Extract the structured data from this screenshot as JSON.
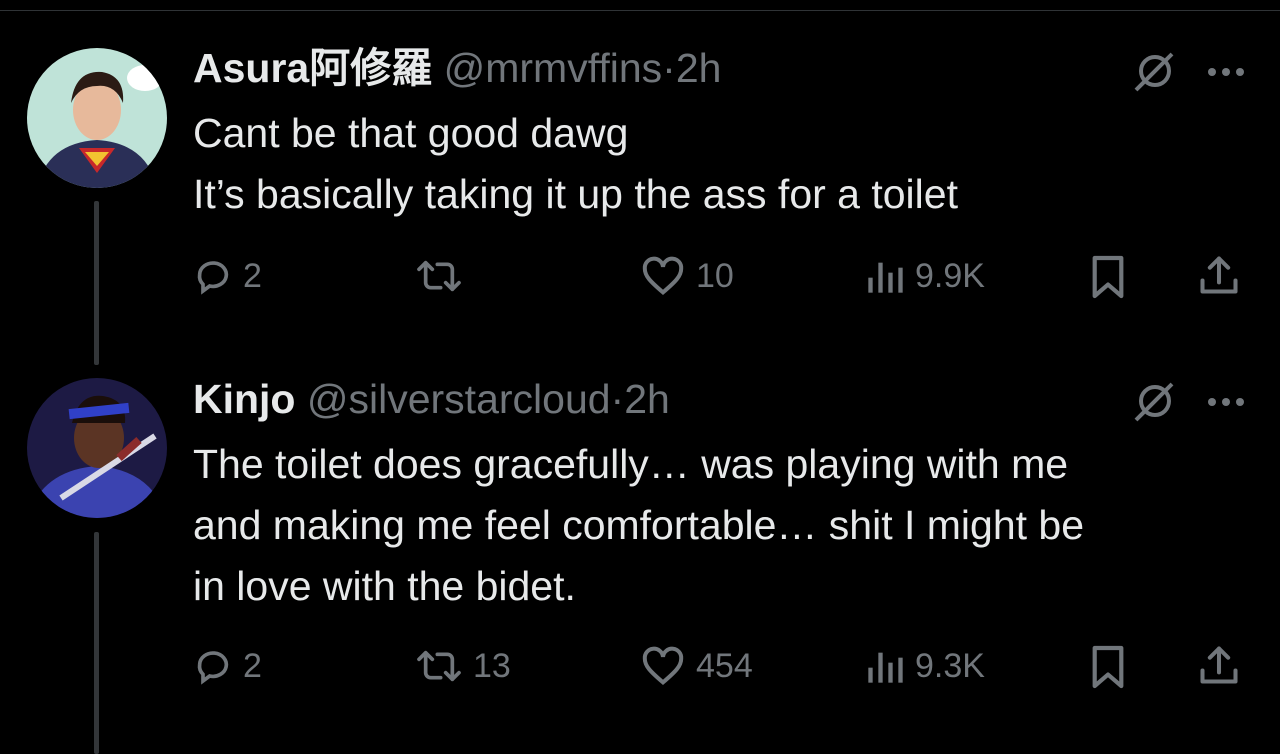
{
  "tweets": [
    {
      "name": "Asura阿修羅",
      "handle": "@mrmvffins",
      "separator": "·",
      "time": "2h",
      "lines": [
        "Cant be that good dawg",
        "It’s basically taking it up the ass for a toilet"
      ],
      "replies": "2",
      "retweets": "",
      "likes": "10",
      "views": "9.9K"
    },
    {
      "name": "Kinjo",
      "handle": "@silverstarcloud",
      "separator": "·",
      "time": "2h",
      "lines": [
        "The toilet does gracefully… was playing with me",
        "and making me feel comfortable… shit I might be",
        "in love with the bidet."
      ],
      "replies": "2",
      "retweets": "13",
      "likes": "454",
      "views": "9.3K"
    }
  ],
  "colors": {
    "background": "#000000",
    "text": "#e7e9ea",
    "muted": "#71767b",
    "thread_line": "#333639"
  },
  "icons": [
    "reply-icon",
    "retweet-icon",
    "like-icon",
    "views-icon",
    "bookmark-icon",
    "share-icon",
    "grok-icon",
    "more-icon"
  ]
}
